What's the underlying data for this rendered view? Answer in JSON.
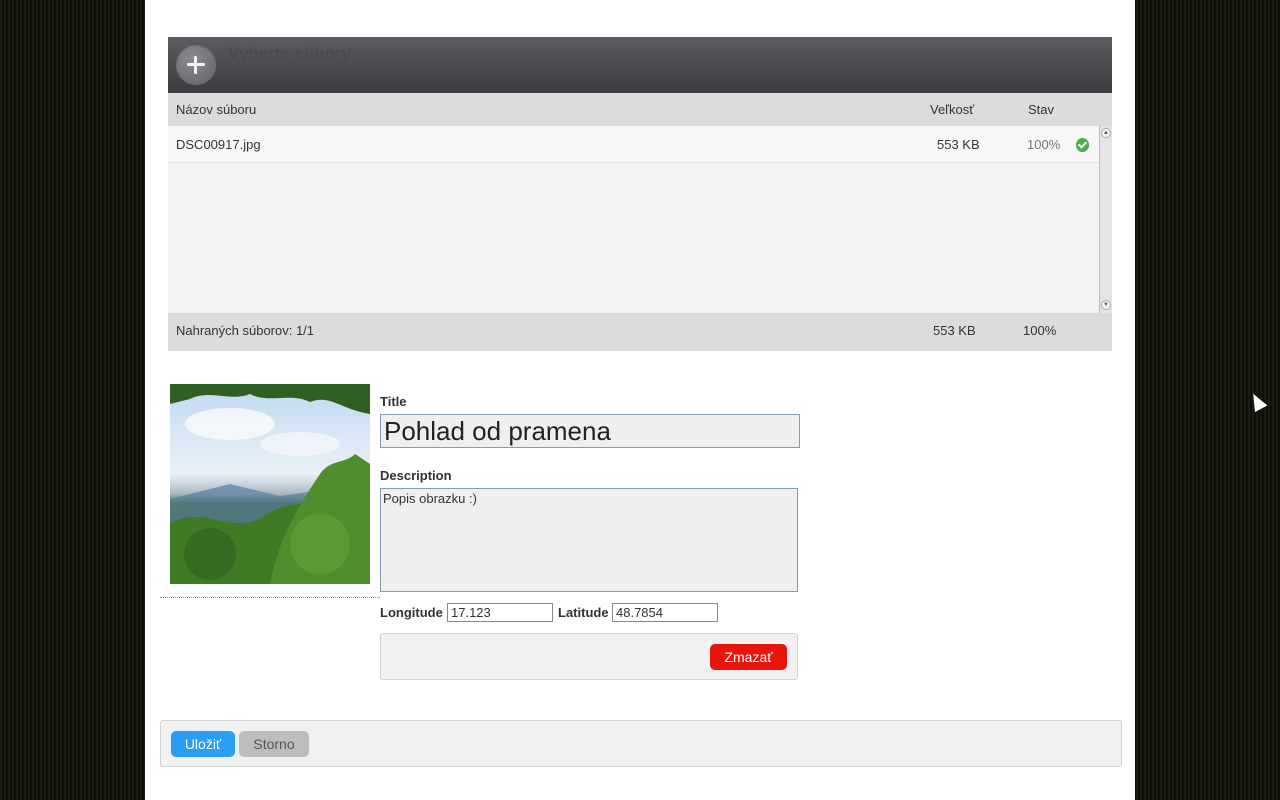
{
  "uploader": {
    "header_title": "Vyberte súbory",
    "header_subtitle": "",
    "columns": {
      "name": "Názov súboru",
      "size": "Veľkosť",
      "status": "Stav"
    },
    "files": [
      {
        "name": "DSC00917.jpg",
        "size": "553 KB",
        "percent": "100%",
        "status_icon": "check-circle-icon"
      }
    ],
    "footer": {
      "uploaded": "Nahraných súborov: 1/1",
      "total_size": "553 KB",
      "total_percent": "100%"
    }
  },
  "item": {
    "title_label": "Title",
    "title_value": "Pohlad od pramena",
    "description_label": "Description",
    "description_value": "Popis obrazku :)",
    "longitude_label": "Longitude",
    "longitude_value": "17.123",
    "latitude_label": "Latitude",
    "latitude_value": "48.7854",
    "delete_label": "Zmazať"
  },
  "actions": {
    "save_label": "Uložiť",
    "cancel_label": "Storno"
  },
  "colors": {
    "delete": "#e8140e",
    "save": "#2a9df4",
    "cancel": "#bdbdbd",
    "header": "#3a3c40"
  }
}
